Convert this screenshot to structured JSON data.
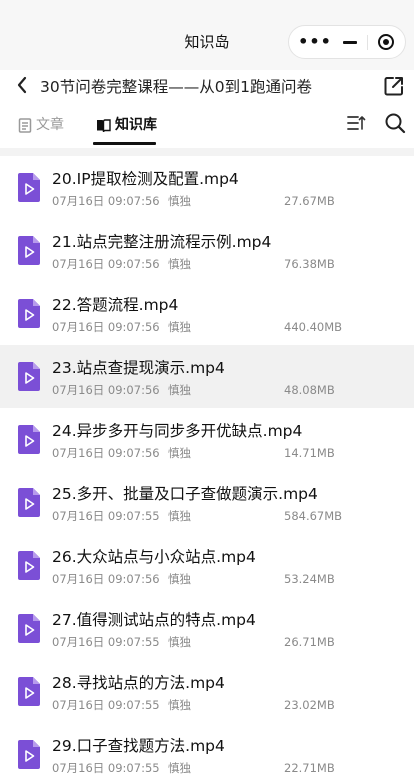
{
  "app": {
    "title": "知识岛",
    "capsule": {
      "more_icon": "more-dots-icon",
      "minimize_icon": "minus-icon",
      "close_icon": "target-icon"
    }
  },
  "header": {
    "course_title": "30节问卷完整课程——从0到1跑通问卷",
    "back_icon": "chevron-left-icon",
    "share_icon": "share-icon"
  },
  "tabs": [
    {
      "label": "文章",
      "icon": "document-icon",
      "active": false
    },
    {
      "label": "知识库",
      "icon": "book-icon",
      "active": true
    }
  ],
  "toolbar": {
    "sort_icon": "sort-icon",
    "search_icon": "search-icon"
  },
  "colors": {
    "file_icon": "#7b4fd6",
    "highlight_row": "#f1f1f1"
  },
  "files": [
    {
      "name": "20.IP提取检测及配置.mp4",
      "date": "07月16日 09:07:56",
      "author": "慎独",
      "size": "27.67MB"
    },
    {
      "name": "21.站点完整注册流程示例.mp4",
      "date": "07月16日 09:07:56",
      "author": "慎独",
      "size": "76.38MB"
    },
    {
      "name": "22.答题流程.mp4",
      "date": "07月16日 09:07:56",
      "author": "慎独",
      "size": "440.40MB"
    },
    {
      "name": "23.站点查提现演示.mp4",
      "date": "07月16日 09:07:56",
      "author": "慎独",
      "size": "48.08MB",
      "highlighted": true
    },
    {
      "name": "24.异步多开与同步多开优缺点.mp4",
      "date": "07月16日 09:07:56",
      "author": "慎独",
      "size": "14.71MB"
    },
    {
      "name": "25.多开、批量及口子查做题演示.mp4",
      "date": "07月16日 09:07:55",
      "author": "慎独",
      "size": "584.67MB"
    },
    {
      "name": "26.大众站点与小众站点.mp4",
      "date": "07月16日 09:07:56",
      "author": "慎独",
      "size": "53.24MB"
    },
    {
      "name": "27.值得测试站点的特点.mp4",
      "date": "07月16日 09:07:55",
      "author": "慎独",
      "size": "26.71MB"
    },
    {
      "name": "28.寻找站点的方法.mp4",
      "date": "07月16日 09:07:55",
      "author": "慎独",
      "size": "23.02MB"
    },
    {
      "name": "29.口子查找题方法.mp4",
      "date": "07月16日 09:07:55",
      "author": "慎独",
      "size": "22.71MB"
    }
  ]
}
